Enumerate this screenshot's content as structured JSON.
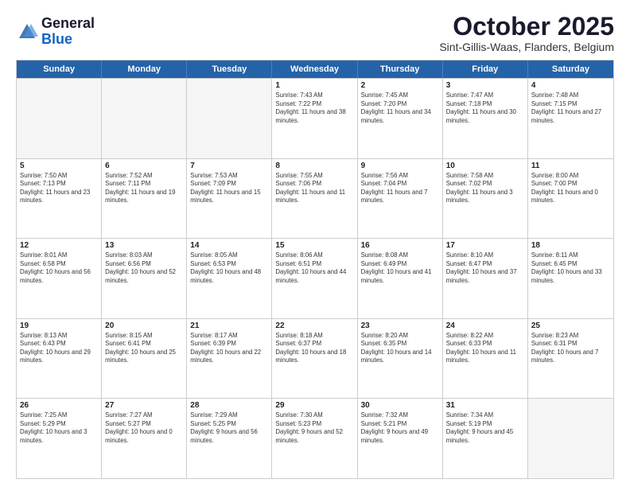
{
  "header": {
    "logo_line1": "General",
    "logo_line2": "Blue",
    "month": "October 2025",
    "location": "Sint-Gillis-Waas, Flanders, Belgium"
  },
  "days_of_week": [
    "Sunday",
    "Monday",
    "Tuesday",
    "Wednesday",
    "Thursday",
    "Friday",
    "Saturday"
  ],
  "weeks": [
    [
      {
        "day": "",
        "empty": true
      },
      {
        "day": "",
        "empty": true
      },
      {
        "day": "",
        "empty": true
      },
      {
        "day": "1",
        "sunrise": "7:43 AM",
        "sunset": "7:22 PM",
        "daylight": "11 hours and 38 minutes."
      },
      {
        "day": "2",
        "sunrise": "7:45 AM",
        "sunset": "7:20 PM",
        "daylight": "11 hours and 34 minutes."
      },
      {
        "day": "3",
        "sunrise": "7:47 AM",
        "sunset": "7:18 PM",
        "daylight": "11 hours and 30 minutes."
      },
      {
        "day": "4",
        "sunrise": "7:48 AM",
        "sunset": "7:15 PM",
        "daylight": "11 hours and 27 minutes."
      }
    ],
    [
      {
        "day": "5",
        "sunrise": "7:50 AM",
        "sunset": "7:13 PM",
        "daylight": "11 hours and 23 minutes."
      },
      {
        "day": "6",
        "sunrise": "7:52 AM",
        "sunset": "7:11 PM",
        "daylight": "11 hours and 19 minutes."
      },
      {
        "day": "7",
        "sunrise": "7:53 AM",
        "sunset": "7:09 PM",
        "daylight": "11 hours and 15 minutes."
      },
      {
        "day": "8",
        "sunrise": "7:55 AM",
        "sunset": "7:06 PM",
        "daylight": "11 hours and 11 minutes."
      },
      {
        "day": "9",
        "sunrise": "7:56 AM",
        "sunset": "7:04 PM",
        "daylight": "11 hours and 7 minutes."
      },
      {
        "day": "10",
        "sunrise": "7:58 AM",
        "sunset": "7:02 PM",
        "daylight": "11 hours and 3 minutes."
      },
      {
        "day": "11",
        "sunrise": "8:00 AM",
        "sunset": "7:00 PM",
        "daylight": "11 hours and 0 minutes."
      }
    ],
    [
      {
        "day": "12",
        "sunrise": "8:01 AM",
        "sunset": "6:58 PM",
        "daylight": "10 hours and 56 minutes."
      },
      {
        "day": "13",
        "sunrise": "8:03 AM",
        "sunset": "6:56 PM",
        "daylight": "10 hours and 52 minutes."
      },
      {
        "day": "14",
        "sunrise": "8:05 AM",
        "sunset": "6:53 PM",
        "daylight": "10 hours and 48 minutes."
      },
      {
        "day": "15",
        "sunrise": "8:06 AM",
        "sunset": "6:51 PM",
        "daylight": "10 hours and 44 minutes."
      },
      {
        "day": "16",
        "sunrise": "8:08 AM",
        "sunset": "6:49 PM",
        "daylight": "10 hours and 41 minutes."
      },
      {
        "day": "17",
        "sunrise": "8:10 AM",
        "sunset": "6:47 PM",
        "daylight": "10 hours and 37 minutes."
      },
      {
        "day": "18",
        "sunrise": "8:11 AM",
        "sunset": "6:45 PM",
        "daylight": "10 hours and 33 minutes."
      }
    ],
    [
      {
        "day": "19",
        "sunrise": "8:13 AM",
        "sunset": "6:43 PM",
        "daylight": "10 hours and 29 minutes."
      },
      {
        "day": "20",
        "sunrise": "8:15 AM",
        "sunset": "6:41 PM",
        "daylight": "10 hours and 25 minutes."
      },
      {
        "day": "21",
        "sunrise": "8:17 AM",
        "sunset": "6:39 PM",
        "daylight": "10 hours and 22 minutes."
      },
      {
        "day": "22",
        "sunrise": "8:18 AM",
        "sunset": "6:37 PM",
        "daylight": "10 hours and 18 minutes."
      },
      {
        "day": "23",
        "sunrise": "8:20 AM",
        "sunset": "6:35 PM",
        "daylight": "10 hours and 14 minutes."
      },
      {
        "day": "24",
        "sunrise": "8:22 AM",
        "sunset": "6:33 PM",
        "daylight": "10 hours and 11 minutes."
      },
      {
        "day": "25",
        "sunrise": "8:23 AM",
        "sunset": "6:31 PM",
        "daylight": "10 hours and 7 minutes."
      }
    ],
    [
      {
        "day": "26",
        "sunrise": "7:25 AM",
        "sunset": "5:29 PM",
        "daylight": "10 hours and 3 minutes."
      },
      {
        "day": "27",
        "sunrise": "7:27 AM",
        "sunset": "5:27 PM",
        "daylight": "10 hours and 0 minutes."
      },
      {
        "day": "28",
        "sunrise": "7:29 AM",
        "sunset": "5:25 PM",
        "daylight": "9 hours and 56 minutes."
      },
      {
        "day": "29",
        "sunrise": "7:30 AM",
        "sunset": "5:23 PM",
        "daylight": "9 hours and 52 minutes."
      },
      {
        "day": "30",
        "sunrise": "7:32 AM",
        "sunset": "5:21 PM",
        "daylight": "9 hours and 49 minutes."
      },
      {
        "day": "31",
        "sunrise": "7:34 AM",
        "sunset": "5:19 PM",
        "daylight": "9 hours and 45 minutes."
      },
      {
        "day": "",
        "empty": true
      }
    ]
  ]
}
